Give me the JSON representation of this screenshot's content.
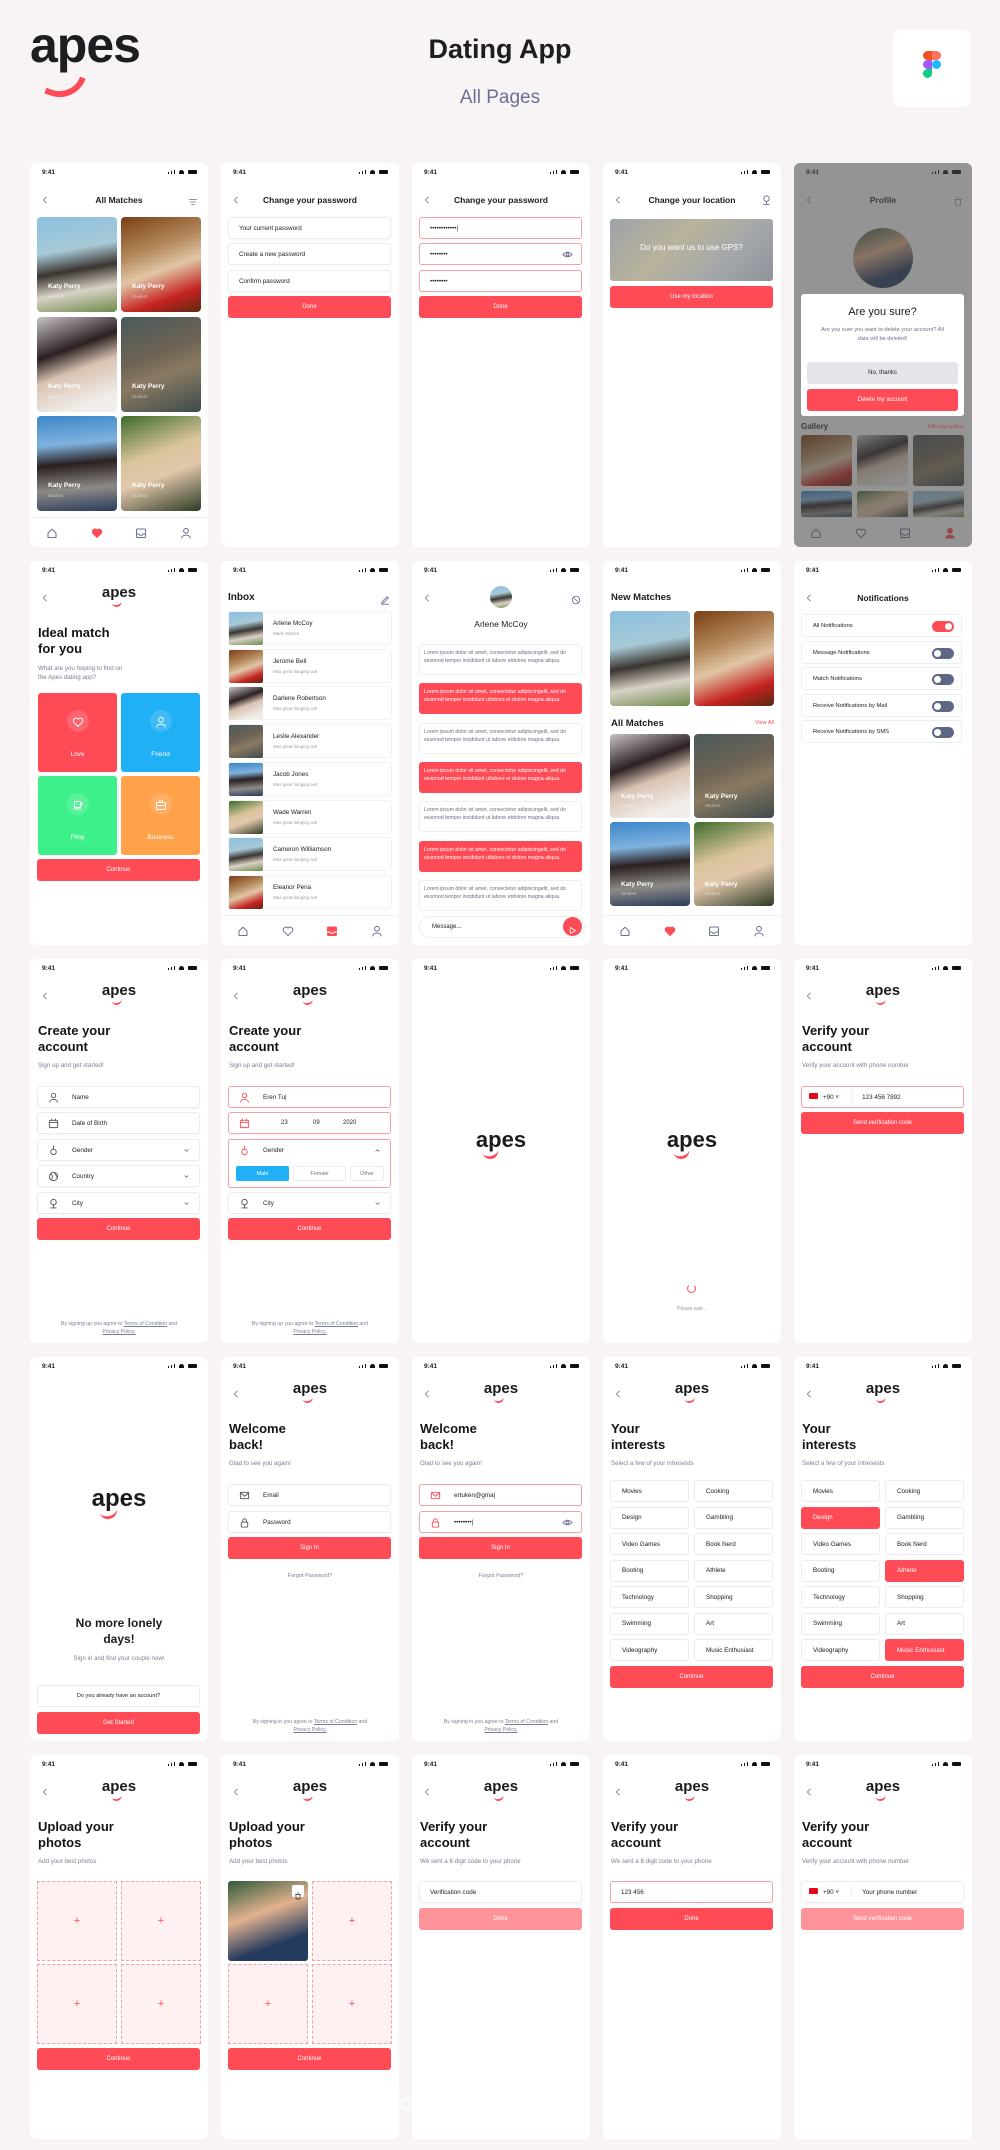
{
  "header": {
    "logo": "apes",
    "title": "Dating App",
    "subtitle": "All Pages",
    "figma_icon": "figma-logo-icon"
  },
  "status_time": "9:41",
  "watermark": "www.youngem.com",
  "colors": {
    "accent": "#ff4b55",
    "accent_disabled": "#fe9399",
    "love": "#ff4b55",
    "friend": "#1fb0f5",
    "fling": "#3ef08a",
    "business": "#ffa24a",
    "background": "#f8f4f5",
    "text_muted": "#7b7f96"
  },
  "s": {
    "all_matches": {
      "title": "All Matches",
      "cards": [
        {
          "name": "Katy Perry",
          "role": "Student"
        },
        {
          "name": "Katy Perry",
          "role": "Student"
        },
        {
          "name": "Katy Perry",
          "role": "Student"
        },
        {
          "name": "Katy Perry",
          "role": "Student"
        },
        {
          "name": "Katy Perry",
          "role": "Student"
        },
        {
          "name": "Katy Perry",
          "role": "Student"
        }
      ]
    },
    "change_password": {
      "title": "Change your password",
      "fields": [
        "Your current password",
        "Create a new password",
        "Confirm password"
      ],
      "button": "Done"
    },
    "change_password_filled": {
      "title": "Change your password",
      "values": [
        "••••••••••••|",
        "••••••••",
        "••••••••"
      ],
      "button": "Done"
    },
    "change_location": {
      "title": "Change your location",
      "map_text": "Do you want us to use GPS?",
      "button": "Use my location"
    },
    "profile_delete": {
      "title": "Profile",
      "dialog_title": "Are you sure?",
      "dialog_text": "Are you sure you want to delete your account? All data will be deleted!",
      "cancel": "No, thanks",
      "confirm": "Delete my account",
      "gallery": "Gallery",
      "edit_gallery": "Edit your gallery"
    },
    "ideal_match": {
      "logo": "apes",
      "heading": [
        "Ideal match",
        "for you"
      ],
      "subtitle": [
        "What are you hoping to find on",
        "the Apes dating app?"
      ],
      "options": [
        {
          "label": "Love",
          "icon": "heart-icon",
          "color": "#ff4b55"
        },
        {
          "label": "Friend",
          "icon": "friend-icon",
          "color": "#1fb0f5"
        },
        {
          "label": "Fling",
          "icon": "cup-icon",
          "color": "#3ef08a"
        },
        {
          "label": "Business",
          "icon": "briefcase-icon",
          "color": "#ffa24a"
        }
      ],
      "button": "Continue"
    },
    "inbox": {
      "title": "Inbox",
      "items": [
        {
          "name": "Arlene McCoy",
          "message": "Wade Warren"
        },
        {
          "name": "Jerome Bell",
          "message": "Was great hanging out!"
        },
        {
          "name": "Darlene Robertson",
          "message": "Was great hanging out!"
        },
        {
          "name": "Leslie Alexander",
          "message": "Was great hanging out!"
        },
        {
          "name": "Jacob Jones",
          "message": "Was great hanging out!"
        },
        {
          "name": "Wade Warren",
          "message": "Was great hanging out!"
        },
        {
          "name": "Cameron Williamson",
          "message": "Was great hanging out!"
        },
        {
          "name": "Eleanor Pena",
          "message": "Was great hanging out!"
        }
      ]
    },
    "chat": {
      "name": "Arlene McCoy",
      "placeholder": "Message...",
      "messages": [
        {
          "text": "Lorem ipsum dolor sit amet, consectetur adipiscingelit, sed do eiusmod tempor incididunt ut labore etdolore magna aliqua.",
          "mine": false
        },
        {
          "text": "Lorem ipsum dolor sit amet, consectetur adipiscingelit, sed do eiusmod tempor incididunt utlabore et dolore magna aliqua.",
          "mine": true
        },
        {
          "text": "Lorem ipsum dolor sit amet, consectetur adipiscingelit, sed do eiusmod tempor incididunt ut labore etdolore magna aliqua.",
          "mine": false
        },
        {
          "text": "Lorem ipsum dolor sit amet, consectetur adipiscingelit, sed do eiusmod tempor incididunt utlabore et dolore magna aliqua.",
          "mine": true
        },
        {
          "text": "Lorem ipsum dolor sit amet, consectetur adipiscingelit, sed do eiusmod tempor incididunt ut labore etdolore magna aliqua.",
          "mine": false
        },
        {
          "text": "Lorem ipsum dolor sit amet, consectetur adipiscingelit, sed do eiusmod tempor incididunt utlabore et dolore magna aliqua.",
          "mine": true
        },
        {
          "text": "Lorem ipsum dolor sit amet, consectetur adipiscingelit, sed do eiusmod tempor incididunt ut labore etdolore magna aliqua.",
          "mine": false
        }
      ]
    },
    "matches": {
      "new_title": "New Matches",
      "all_title": "All Matches",
      "view_all": "View All",
      "cards": [
        {
          "name": "Katy Perry",
          "role": "Student"
        },
        {
          "name": "Katy Perry",
          "role": "Student"
        },
        {
          "name": "Katy Perry",
          "role": "Student"
        },
        {
          "name": "Katy Perry",
          "role": "Student"
        }
      ]
    },
    "notifications": {
      "title": "Notifications",
      "items": [
        {
          "label": "All Notifications",
          "on": true
        },
        {
          "label": "Message Notifications",
          "on": false
        },
        {
          "label": "Match Notifications",
          "on": false
        },
        {
          "label": "Receive Notifications by Mail",
          "on": false
        },
        {
          "label": "Receive Notifications by SMS",
          "on": false
        }
      ]
    },
    "create_account": {
      "logo": "apes",
      "heading": [
        "Create your",
        "account"
      ],
      "subtitle": "Sign up and get started!",
      "fields": [
        "Name",
        "Date of Birth",
        "Gender",
        "Country",
        "City"
      ],
      "button": "Continue",
      "terms_prefix": "By signing up you agree to",
      "terms_link": "Terms of Condition",
      "terms_and": "and",
      "privacy": "Privacy Policy."
    },
    "create_account_filled": {
      "name_value": "Eren Tu|",
      "dob": [
        "23",
        "09",
        "2020"
      ],
      "gender_label": "Gender",
      "gender_options": [
        "Male",
        "Female",
        "Other"
      ],
      "gender_selected": "Male",
      "city": "City"
    },
    "splash": {
      "logo": "apes"
    },
    "loading": {
      "logo": "apes",
      "text": "Please wait..."
    },
    "verify_phone": {
      "logo": "apes",
      "heading": [
        "Verify your",
        "account"
      ],
      "subtitle": "Verify your account with phone number",
      "country_code": "+90",
      "phone": "123 456 7892",
      "button": "Send verification code"
    },
    "onboarding": {
      "logo": "apes",
      "heading": [
        "No more lonely",
        "days!"
      ],
      "subtitle": "Sign in and find your couple now!",
      "secondary": "Do you already have an account?",
      "primary": "Get Started"
    },
    "sign_in": {
      "logo": "apes",
      "heading": [
        "Welcome",
        "back!"
      ],
      "subtitle": "Glad to see you again!",
      "email": "Email",
      "password": "Password",
      "button": "Sign In",
      "forgot": "Forgot Password?",
      "terms_prefix": "By signing in you agree to",
      "terms_link": "Terms of Condition",
      "terms_and": "and",
      "privacy": "Privacy Policy."
    },
    "sign_in_filled": {
      "email": "ertuken@gma|",
      "password": "••••••••|"
    },
    "interests": {
      "logo": "apes",
      "heading": [
        "Your",
        "interests"
      ],
      "subtitle": "Select a few of your intresests",
      "items": [
        "Movies",
        "Cooking",
        "Design",
        "Gambling",
        "Video Games",
        "Book Nerd",
        "Booting",
        "Athlete",
        "Technology",
        "Shopping",
        "Swimming",
        "Art",
        "Videography",
        "Music Enthusiast"
      ],
      "button": "Continue"
    },
    "interests_selected": {
      "selected": [
        "Design",
        "Athlete",
        "Music Enthusiast"
      ]
    },
    "upload": {
      "logo": "apes",
      "heading": [
        "Upload your",
        "photos"
      ],
      "subtitle": "Add your best photos",
      "button": "Continue"
    },
    "verify_code": {
      "logo": "apes",
      "heading": [
        "Verify your",
        "account"
      ],
      "subtitle": "We sent a 6 digit code to your phone",
      "placeholder": "Verification code",
      "button": "Done"
    },
    "verify_code_filled": {
      "value": "123 456"
    },
    "verify_phone_empty": {
      "placeholder": "Your phone number"
    }
  }
}
